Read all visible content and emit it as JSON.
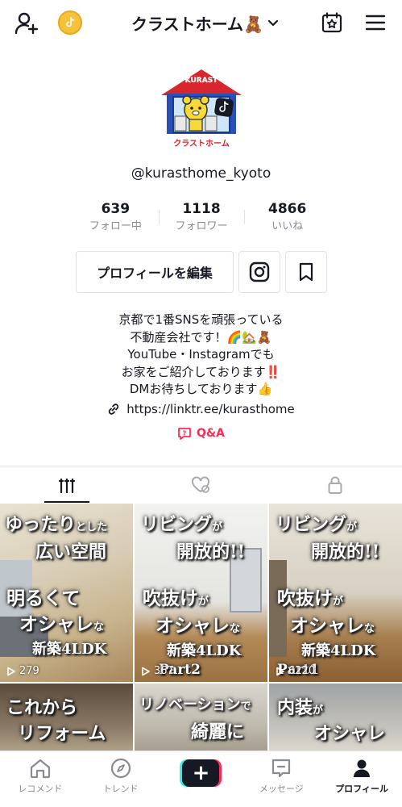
{
  "header": {
    "title": "クラストホーム🧸",
    "add_user_icon": "add-user-icon",
    "coin_icon": "coin-icon",
    "dropdown_icon": "chevron-down-icon",
    "calendar_icon": "calendar-star-icon",
    "menu_icon": "hamburger-icon"
  },
  "profile": {
    "logo_text_top": "KURAST",
    "logo_text_mid": "HOME",
    "logo_text_bottom": "クラストホーム",
    "username": "@kurasthome_kyoto",
    "stats": [
      {
        "value": "639",
        "label": "フォロー中"
      },
      {
        "value": "1118",
        "label": "フォロワー"
      },
      {
        "value": "4866",
        "label": "いいね"
      }
    ],
    "edit_button": "プロフィールを編集",
    "bio_lines": [
      "京都で1番SNSを頑張っている",
      "不動産会社です！🌈🏡🧸",
      "YouTube・Instagramでも",
      "お家をご紹介しております‼️",
      "DMお待ちしております👍"
    ],
    "link": "https://linktr.ee/kurasthome",
    "qa_label": "Q&A"
  },
  "tabs": [
    "videos",
    "liked",
    "private"
  ],
  "videos": [
    {
      "caption1a": "ゆったり",
      "caption1b": "とした",
      "caption2": "広い空間",
      "caption3": "明るくて",
      "caption4a": "オシャレ",
      "caption4b": "な",
      "views": "279",
      "part": ""
    },
    {
      "caption1a": "リビング",
      "caption1b": "が",
      "caption2": "開放的!!",
      "caption3a": "吹抜け",
      "caption3b": "が",
      "caption4a": "オシャレ",
      "caption4b": "な",
      "caption5": "新築4LDK",
      "views": "367",
      "part": "Part2"
    },
    {
      "caption1a": "リビング",
      "caption1b": "が",
      "caption2": "開放的!!",
      "caption3a": "吹抜け",
      "caption3b": "が",
      "caption4a": "オシャレ",
      "caption4b": "な",
      "caption5": "新築4LDK",
      "views": "6220",
      "part": "Part1"
    },
    {
      "caption1": "これから",
      "caption2": "リフォーム"
    },
    {
      "caption1a": "リノベーション",
      "caption1b": "で",
      "caption2": "綺麗に"
    },
    {
      "caption1a": "内装",
      "caption1b": "が",
      "caption2": "オシャレ"
    }
  ],
  "video0_extra": "新築4LDK",
  "bottom_nav": [
    {
      "label": "レコメンド",
      "icon": "home-icon"
    },
    {
      "label": "トレンド",
      "icon": "compass-icon"
    },
    {
      "label": "",
      "icon": "plus-icon"
    },
    {
      "label": "メッセージ",
      "icon": "message-icon"
    },
    {
      "label": "プロフィール",
      "icon": "profile-icon"
    }
  ]
}
